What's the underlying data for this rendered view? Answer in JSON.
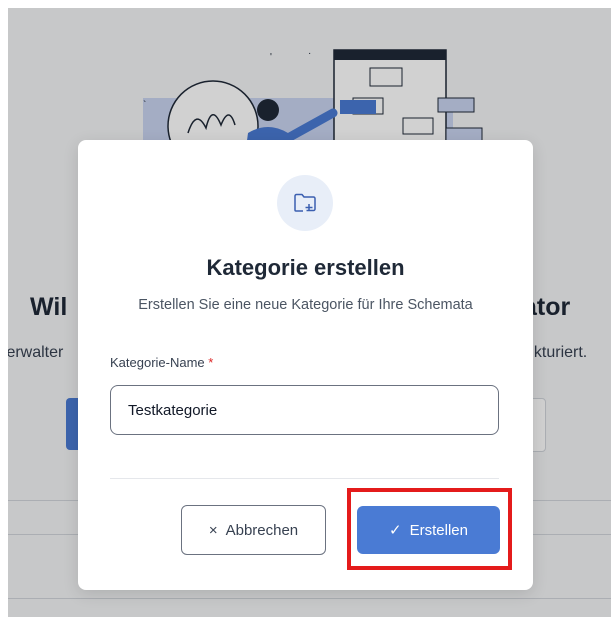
{
  "background": {
    "title_left": "Wil",
    "title_right": "ator",
    "subtitle_left": "/erwalter",
    "subtitle_right": "ukturiert."
  },
  "modal": {
    "icon": "folder-plus-icon",
    "title": "Kategorie erstellen",
    "description": "Erstellen Sie eine neue Kategorie für Ihre Schemata",
    "field_label": "Kategorie-Name",
    "required_marker": "*",
    "field_value": "Testkategorie",
    "cancel_icon": "×",
    "cancel_label": "Abbrechen",
    "create_icon": "✓",
    "create_label": "Erstellen"
  },
  "colors": {
    "accent": "#4a7bd4",
    "required": "#dc2626",
    "highlight": "#e41b1b"
  }
}
